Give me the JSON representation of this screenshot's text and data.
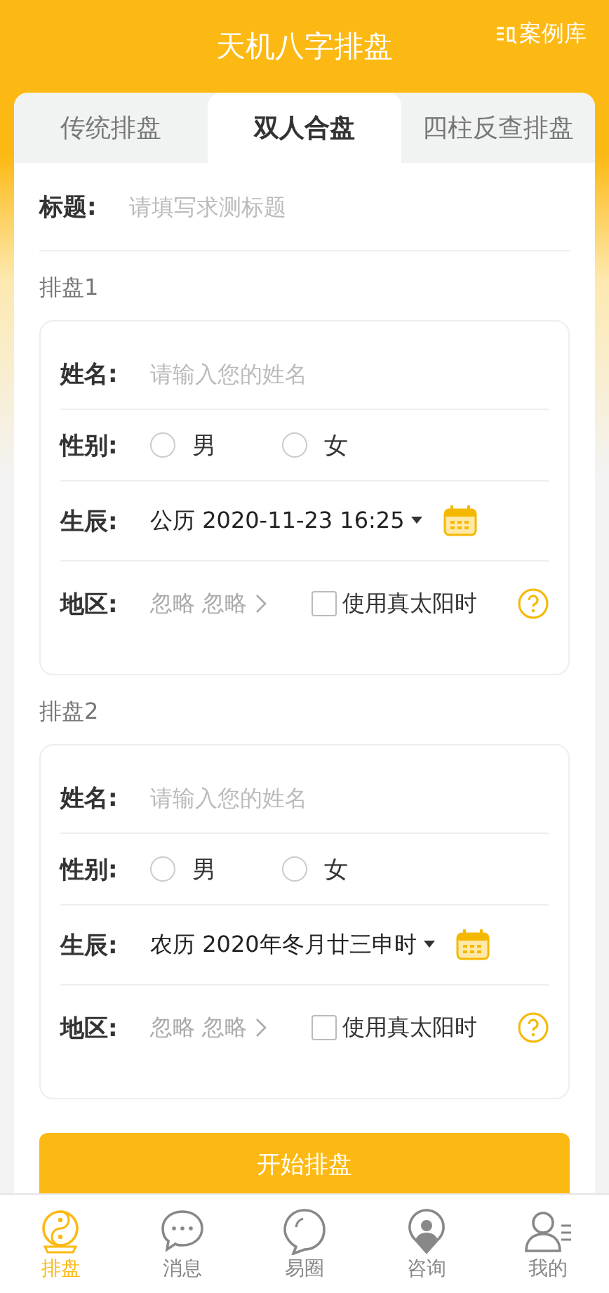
{
  "header": {
    "title": "天机八字排盘",
    "case_link": "案例库"
  },
  "tabs": [
    {
      "label": "传统排盘",
      "selected": false
    },
    {
      "label": "双人合盘",
      "selected": true
    },
    {
      "label": "四柱反查排盘",
      "selected": false
    }
  ],
  "title_field": {
    "label": "标题:",
    "placeholder": "请填写求测标题"
  },
  "charts": [
    {
      "heading": "排盘1",
      "name": {
        "label": "姓名:",
        "placeholder": "请输入您的姓名"
      },
      "gender": {
        "label": "性别:",
        "options": [
          {
            "label": "男",
            "selected": false
          },
          {
            "label": "女",
            "selected": false
          }
        ]
      },
      "birth": {
        "label": "生辰:",
        "value": "公历 2020-11-23 16:25"
      },
      "region": {
        "label": "地区:",
        "value": "忽略 忽略",
        "true_solar": {
          "label": "使用真太阳时",
          "checked": false
        }
      }
    },
    {
      "heading": "排盘2",
      "name": {
        "label": "姓名:",
        "placeholder": "请输入您的姓名"
      },
      "gender": {
        "label": "性别:",
        "options": [
          {
            "label": "男",
            "selected": false
          },
          {
            "label": "女",
            "selected": false
          }
        ]
      },
      "birth": {
        "label": "生辰:",
        "value": "农历 2020年冬月廿三申时"
      },
      "region": {
        "label": "地区:",
        "value": "忽略 忽略",
        "true_solar": {
          "label": "使用真太阳时",
          "checked": false
        }
      }
    }
  ],
  "submit": "开始排盘",
  "bottom_nav": [
    {
      "label": "排盘",
      "selected": true
    },
    {
      "label": "消息",
      "selected": false
    },
    {
      "label": "易圈",
      "selected": false
    },
    {
      "label": "咨询",
      "selected": false
    },
    {
      "label": "我的",
      "selected": false
    }
  ]
}
